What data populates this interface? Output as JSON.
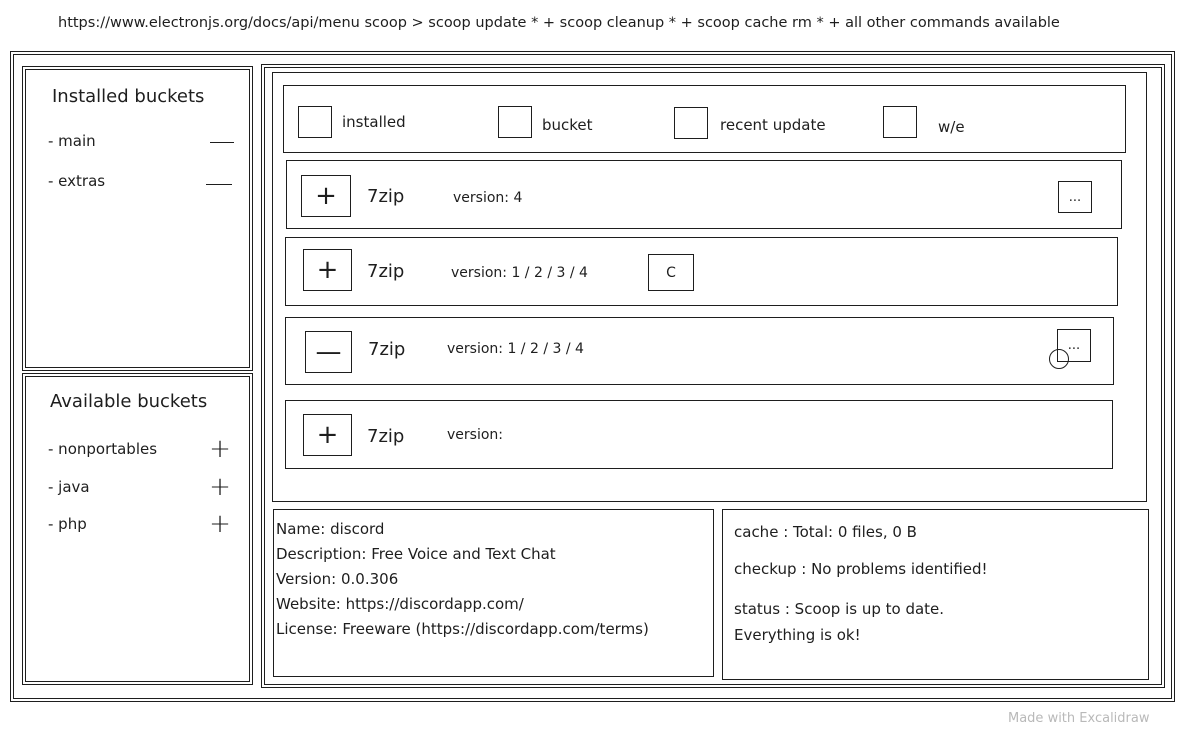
{
  "header_note": "https://www.electronjs.org/docs/api/menu scoop > scoop update * + scoop cleanup * + scoop cache rm * + all other commands available",
  "installed_buckets": {
    "title": "Installed buckets",
    "items": [
      {
        "label": "- main",
        "action": "—"
      },
      {
        "label": "- extras",
        "action": "—"
      }
    ]
  },
  "available_buckets": {
    "title": "Available buckets",
    "items": [
      {
        "label": "- nonportables",
        "action": "+"
      },
      {
        "label": "- java",
        "action": "+"
      },
      {
        "label": "- php",
        "action": "+"
      }
    ]
  },
  "filters": [
    {
      "label": "installed"
    },
    {
      "label": "bucket"
    },
    {
      "label": "recent update"
    },
    {
      "label": "w/e"
    }
  ],
  "apps": [
    {
      "toggle": "+",
      "name": "7zip",
      "version": "version: 4",
      "extra": "..."
    },
    {
      "toggle": "+",
      "name": "7zip",
      "version": "version: 1 / 2 / 3 / 4",
      "extra": "C"
    },
    {
      "toggle": "—",
      "name": "7zip",
      "version": "version: 1 / 2 / 3 / 4",
      "extra": "..."
    },
    {
      "toggle": "+",
      "name": "7zip",
      "version": "version:"
    }
  ],
  "details": {
    "name": "Name: discord",
    "description": "Description: Free Voice and Text Chat",
    "version": "Version: 0.0.306",
    "website": "Website: https://discordapp.com/",
    "license": "License: Freeware (https://discordapp.com/terms)"
  },
  "status_panel": {
    "cache": "cache : Total: 0 files, 0 B",
    "checkup": "checkup : No problems identified!",
    "status": "status : Scoop is up to date.",
    "ok": "Everything is ok!"
  },
  "footer": {
    "watermark": "Made with Excalidraw"
  }
}
